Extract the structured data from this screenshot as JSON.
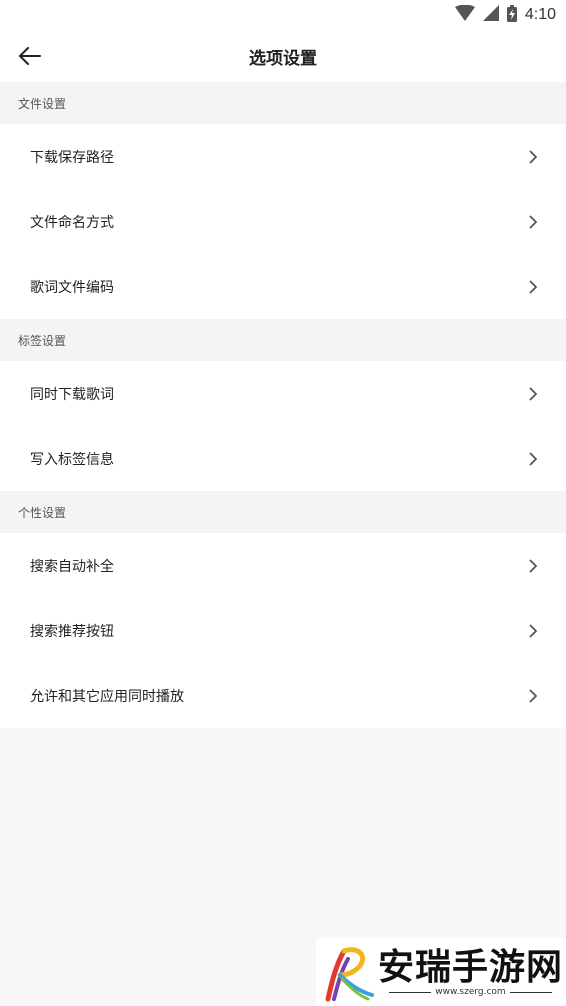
{
  "status_bar": {
    "time": "4:10"
  },
  "app_bar": {
    "title": "选项设置"
  },
  "sections": [
    {
      "header": "文件设置",
      "items": [
        "下载保存路径",
        "文件命名方式",
        "歌词文件编码"
      ]
    },
    {
      "header": "标签设置",
      "items": [
        "同时下载歌词",
        "写入标签信息"
      ]
    },
    {
      "header": "个性设置",
      "items": [
        "搜索自动补全",
        "搜索推荐按钮",
        "允许和其它应用同时播放"
      ]
    }
  ],
  "watermark": {
    "title": "安瑞手游网",
    "url": "www.szerg.com"
  }
}
